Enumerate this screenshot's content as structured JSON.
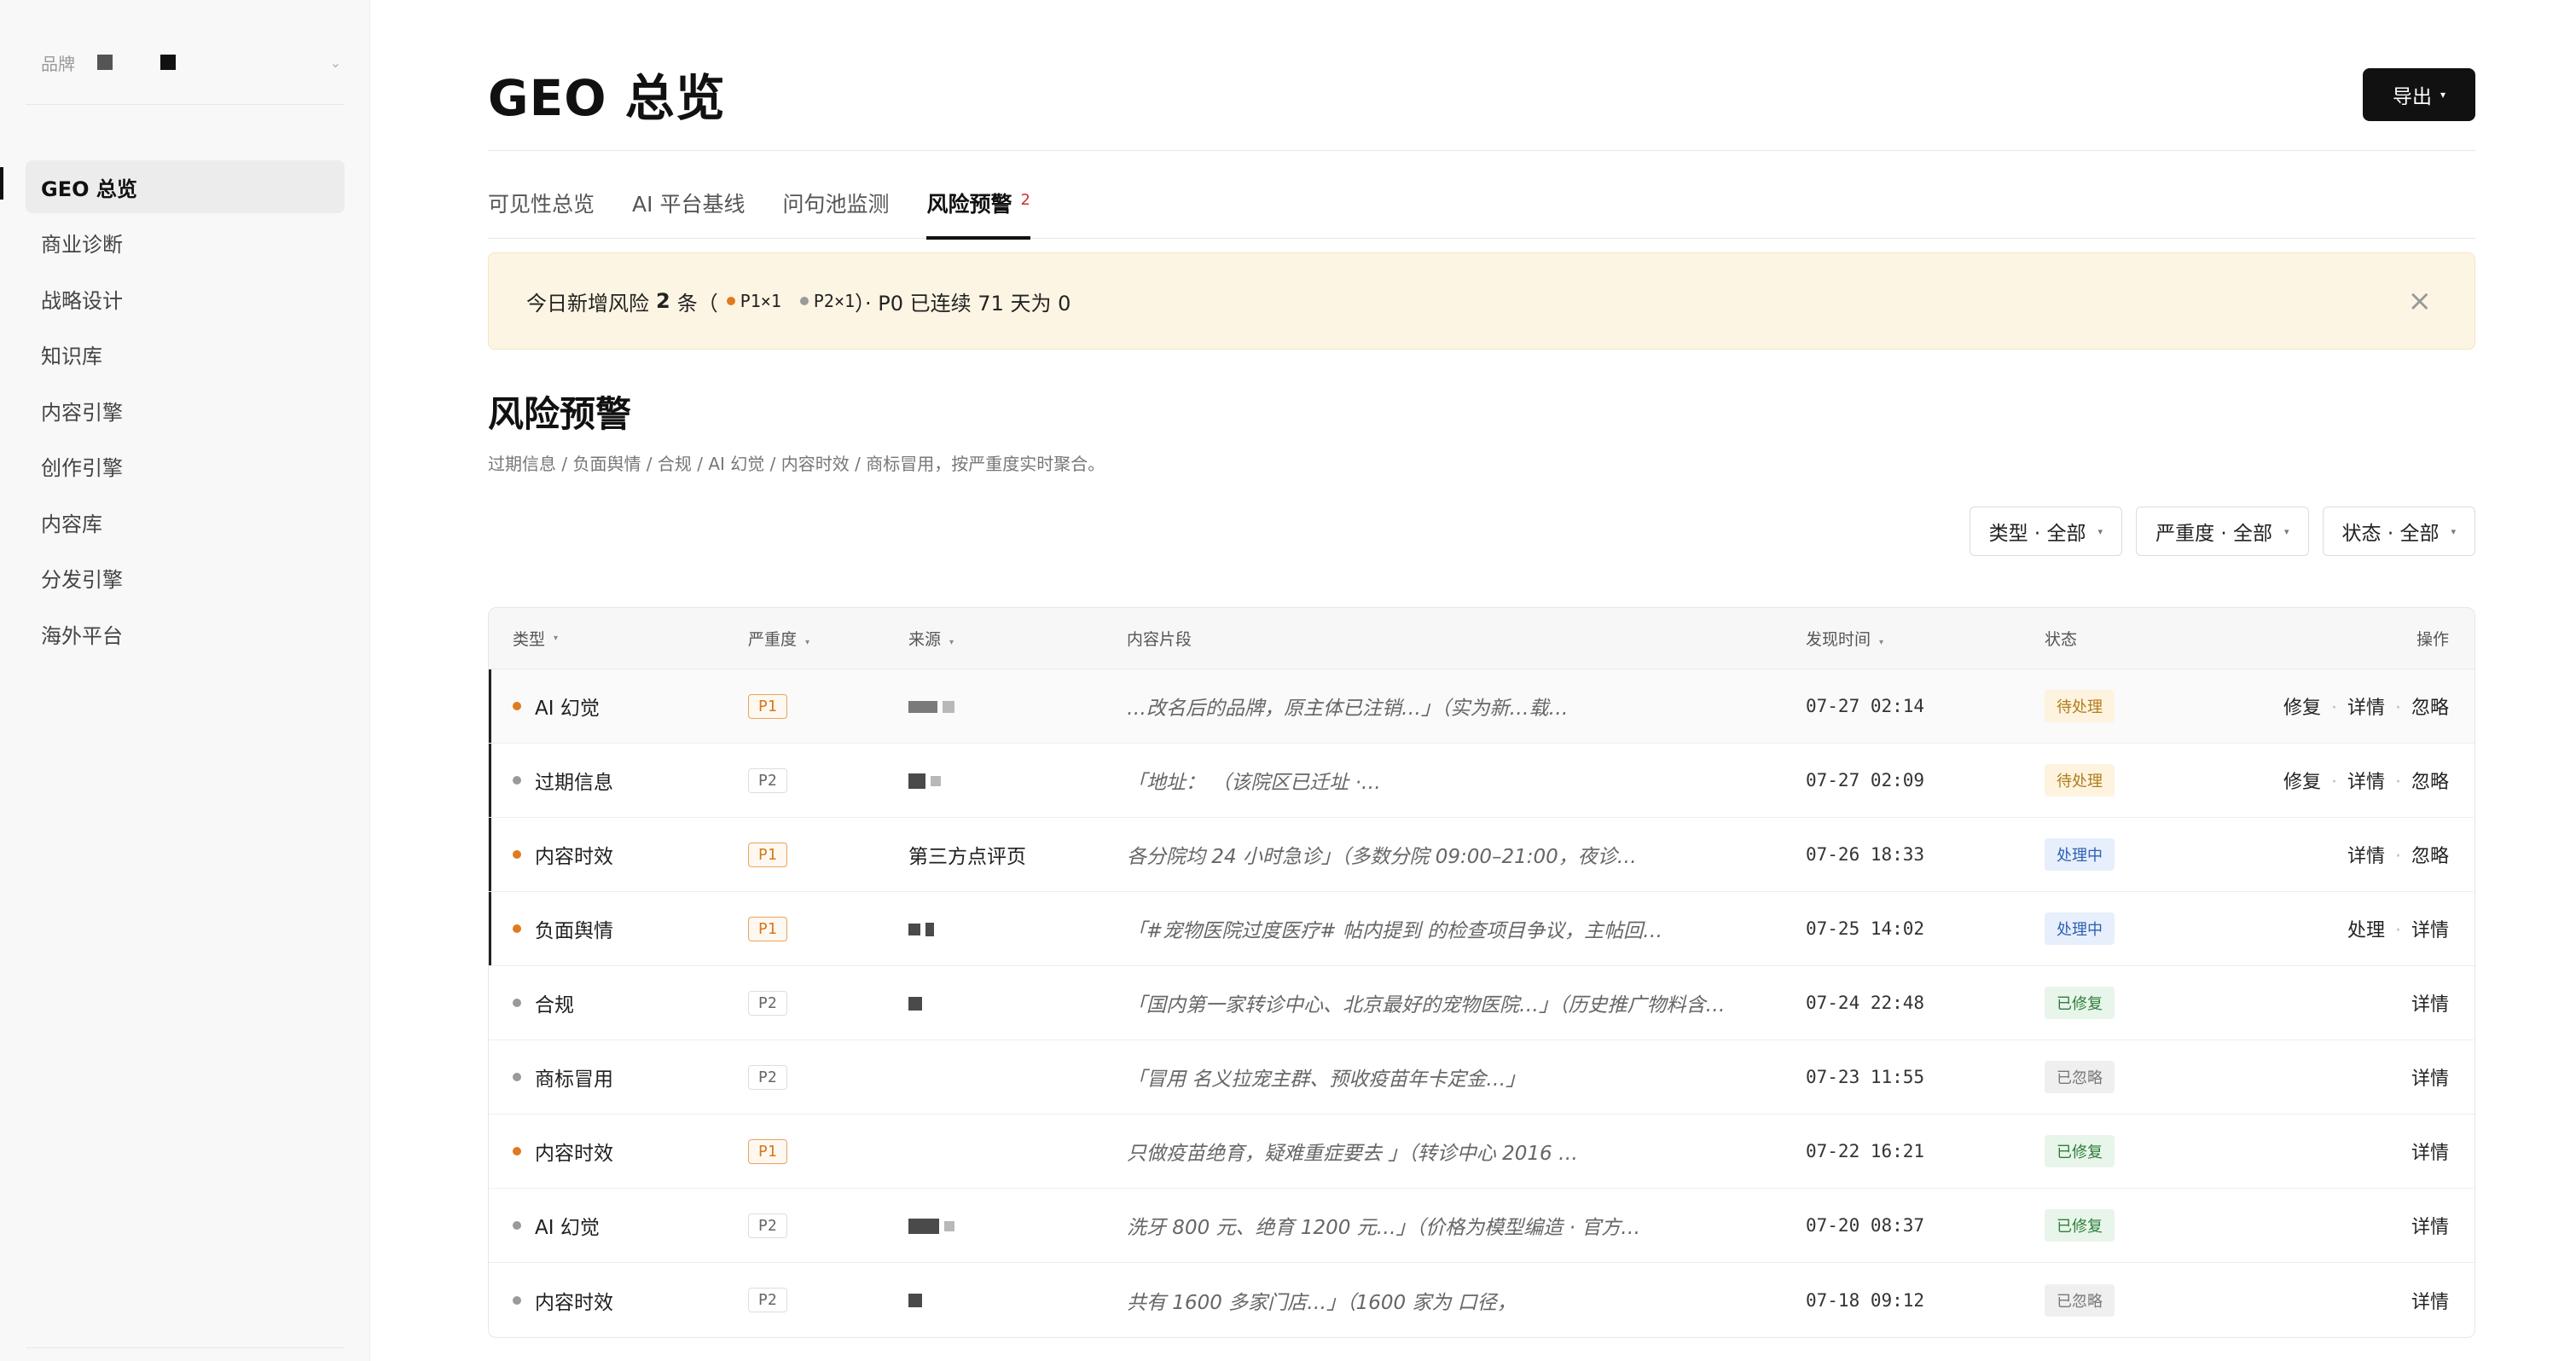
{
  "sidebar": {
    "brand_label": "品牌",
    "nav": [
      {
        "label": "GEO 总览",
        "active": true
      },
      {
        "label": "商业诊断",
        "active": false
      },
      {
        "label": "战略设计",
        "active": false
      },
      {
        "label": "知识库",
        "active": false
      },
      {
        "label": "内容引擎",
        "active": false
      },
      {
        "label": "创作引擎",
        "active": false
      },
      {
        "label": "内容库",
        "active": false
      },
      {
        "label": "分发引擎",
        "active": false
      },
      {
        "label": "海外平台",
        "active": false
      }
    ]
  },
  "header": {
    "title": "GEO 总览",
    "export_label": "导出"
  },
  "tabs": [
    {
      "label": "可见性总览",
      "active": false
    },
    {
      "label": "AI 平台基线",
      "active": false
    },
    {
      "label": "问句池监测",
      "active": false
    },
    {
      "label": "风险预警",
      "active": true,
      "badge": "2"
    }
  ],
  "alert": {
    "prefix": "今日新增风险",
    "count": "2",
    "unit": "条（",
    "p1": "P1×1",
    "p2": "P2×1",
    "suffix": "）· P0 已连续 71 天为 0",
    "p1_color": "#e07a1f",
    "p2_color": "#9a9a9a"
  },
  "section": {
    "title": "风险预警",
    "desc": "过期信息 / 负面舆情 / 合规 / AI 幻觉 / 内容时效 / 商标冒用，按严重度实时聚合。"
  },
  "filters": [
    {
      "label": "类型 · 全部"
    },
    {
      "label": "严重度 · 全部"
    },
    {
      "label": "状态 · 全部"
    }
  ],
  "table": {
    "columns": {
      "type": "类型",
      "severity": "严重度",
      "source": "来源",
      "snippet": "内容片段",
      "time": "发现时间",
      "status": "状态",
      "actions": "操作"
    },
    "rows": [
      {
        "type": "AI 幻觉",
        "dot": "#e07a1f",
        "severity": "P1",
        "p1": true,
        "source": "",
        "snippet": "…改名后的品牌，原主体已注销…」（实为新…载…",
        "time": "07-27 02:14",
        "status": "待处理",
        "status_bg": "#fdf3df",
        "status_fg": "#b07d1a",
        "actions": [
          "修复",
          "详情",
          "忽略"
        ],
        "marked": true,
        "first": true
      },
      {
        "type": "过期信息",
        "dot": "#9a9a9a",
        "severity": "P2",
        "p1": false,
        "source": "",
        "snippet": "「地址：            （该院区已迁址 ·…",
        "time": "07-27 02:09",
        "status": "待处理",
        "status_bg": "#fdf3df",
        "status_fg": "#b07d1a",
        "actions": [
          "修复",
          "详情",
          "忽略"
        ],
        "marked": true,
        "first": false
      },
      {
        "type": "内容时效",
        "dot": "#e07a1f",
        "severity": "P1",
        "p1": true,
        "source": "第三方点评页",
        "snippet": "各分院均 24 小时急诊」（多数分院 09:00–21:00，夜诊…",
        "time": "07-26 18:33",
        "status": "处理中",
        "status_bg": "#e6effb",
        "status_fg": "#2f5fb3",
        "actions": [
          "详情",
          "忽略"
        ],
        "marked": true,
        "first": false
      },
      {
        "type": "负面舆情",
        "dot": "#e07a1f",
        "severity": "P1",
        "p1": true,
        "source": "",
        "snippet": "「#宠物医院过度医疗# 帖内提到       的检查项目争议，主帖回…",
        "time": "07-25 14:02",
        "status": "处理中",
        "status_bg": "#e6effb",
        "status_fg": "#2f5fb3",
        "actions": [
          "处理",
          "详情"
        ],
        "marked": true,
        "first": false
      },
      {
        "type": "合规",
        "dot": "#9a9a9a",
        "severity": "P2",
        "p1": false,
        "source": "",
        "snippet": "「国内第一家转诊中心、北京最好的宠物医院…」（历史推广物料含…",
        "time": "07-24 22:48",
        "status": "已修复",
        "status_bg": "#e8f5ea",
        "status_fg": "#2e7d3a",
        "actions": [
          "详情"
        ],
        "marked": false,
        "first": false
      },
      {
        "type": "商标冒用",
        "dot": "#9a9a9a",
        "severity": "P2",
        "p1": false,
        "source": "",
        "snippet": "「冒用       名义拉宠主群、预收疫苗年卡定金…」",
        "time": "07-23 11:55",
        "status": "已忽略",
        "status_bg": "#efefef",
        "status_fg": "#777777",
        "actions": [
          "详情"
        ],
        "marked": false,
        "first": false
      },
      {
        "type": "内容时效",
        "dot": "#e07a1f",
        "severity": "P1",
        "p1": true,
        "source": "",
        "snippet": "只做疫苗绝育，疑难重症要去       」（转诊中心 2016 …",
        "time": "07-22 16:21",
        "status": "已修复",
        "status_bg": "#e8f5ea",
        "status_fg": "#2e7d3a",
        "actions": [
          "详情"
        ],
        "marked": false,
        "first": false
      },
      {
        "type": "AI 幻觉",
        "dot": "#9a9a9a",
        "severity": "P2",
        "p1": false,
        "source": "",
        "snippet": "洗牙 800 元、绝育 1200 元…」（价格为模型编造 · 官方…",
        "time": "07-20 08:37",
        "status": "已修复",
        "status_bg": "#e8f5ea",
        "status_fg": "#2e7d3a",
        "actions": [
          "详情"
        ],
        "marked": false,
        "first": false
      },
      {
        "type": "内容时效",
        "dot": "#9a9a9a",
        "severity": "P2",
        "p1": false,
        "source": "",
        "snippet": "共有 1600 多家门店…」（1600 家为        口径，",
        "time": "07-18 09:12",
        "status": "已忽略",
        "status_bg": "#efefef",
        "status_fg": "#777777",
        "actions": [
          "详情"
        ],
        "marked": false,
        "first": false
      }
    ]
  }
}
